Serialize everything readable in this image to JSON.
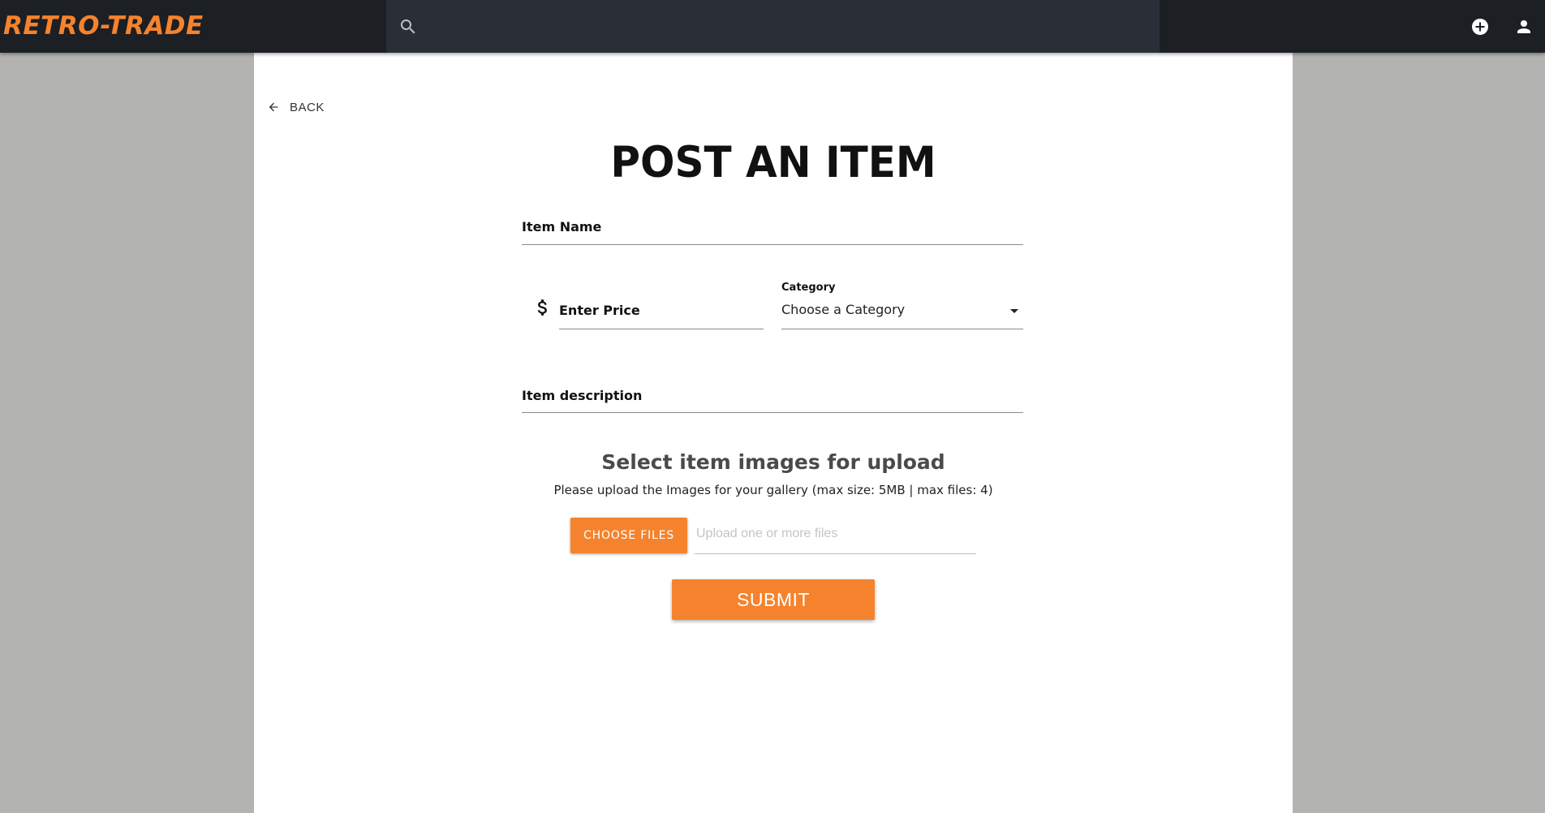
{
  "header": {
    "logo_text": "RETRO-TRADE",
    "search_placeholder": "",
    "icons": [
      "search-icon",
      "add-circle-icon",
      "account-icon"
    ],
    "accent_color": "#f5832d",
    "background_color": "#1c1f24"
  },
  "nav": {
    "back_label": "BACK"
  },
  "page": {
    "title": "POST AN ITEM"
  },
  "form": {
    "item_name": {
      "label": "Item Name",
      "value": ""
    },
    "price": {
      "label": "Enter Price",
      "value": "",
      "currency_icon": "dollar-icon"
    },
    "category": {
      "label": "Category",
      "selected": "Choose a Category"
    },
    "description": {
      "label": "Item description",
      "value": ""
    }
  },
  "upload": {
    "title": "Select item images for upload",
    "hint": "Please upload the Images for your gallery (max size: 5MB | max files: 4)",
    "choose_label": "CHOOSE FILES",
    "file_placeholder": "Upload one or more files"
  },
  "actions": {
    "submit_label": "SUBMIT"
  }
}
